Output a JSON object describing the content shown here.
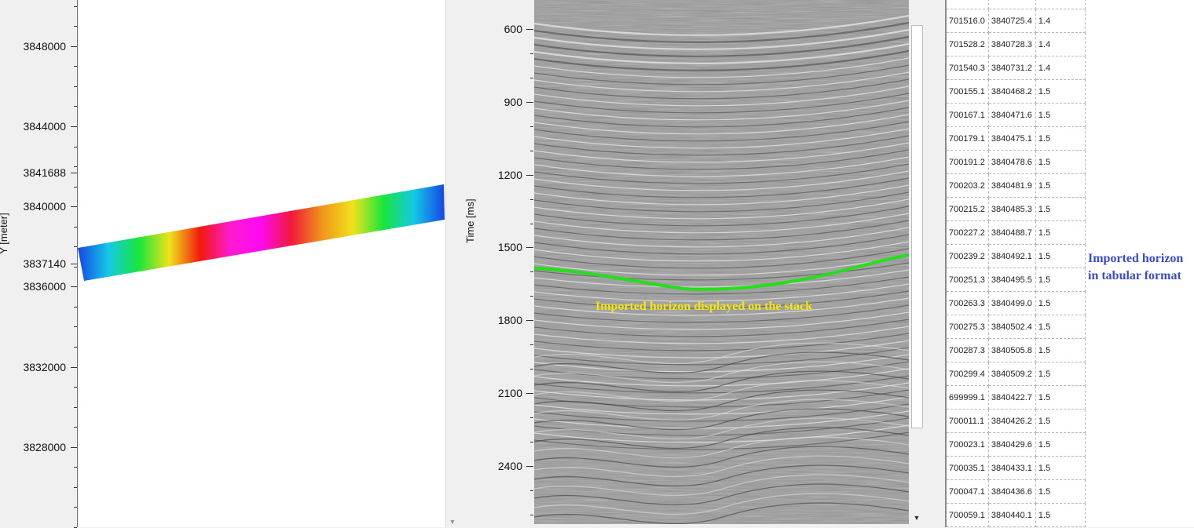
{
  "map_view": {
    "axis_title": "Y [meter]",
    "y_ticks": [
      "3848000",
      "3844000",
      "3841688",
      "3840000",
      "3837140",
      "3836000",
      "3832000",
      "3828000"
    ],
    "y_tick_values": [
      3848000,
      3844000,
      3841688,
      3840000,
      3837140,
      3836000,
      3832000,
      3828000
    ],
    "y_range": [
      3824000,
      3850300
    ],
    "colorbar_colors": [
      "#1546e6",
      "#15c8e6",
      "#18e63c",
      "#f0e21a",
      "#f01a0a",
      "#ff1ad2",
      "#ff0af0",
      "#f01a3a",
      "#f0961a",
      "#f0e21a",
      "#18e63c",
      "#15c8e6",
      "#1546e6"
    ]
  },
  "seismic_view": {
    "axis_title": "Time [ms]",
    "t_ticks": [
      "600",
      "900",
      "1200",
      "1500",
      "1800",
      "2100",
      "2400"
    ],
    "t_tick_values": [
      600,
      900,
      1200,
      1500,
      1800,
      2100,
      2400
    ],
    "t_range": [
      480,
      2640
    ],
    "annotation": "Imported horizon displayed on the stack",
    "horizon_color": "#22e01a"
  },
  "horizon_table": {
    "rows": [
      [
        "701516.0",
        "3840725.4",
        "1.4"
      ],
      [
        "701528.2",
        "3840728.3",
        "1.4"
      ],
      [
        "701540.3",
        "3840731.2",
        "1.4"
      ],
      [
        "700155.1",
        "3840468.2",
        "1.5"
      ],
      [
        "700167.1",
        "3840471.6",
        "1.5"
      ],
      [
        "700179.1",
        "3840475.1",
        "1.5"
      ],
      [
        "700191.2",
        "3840478.6",
        "1.5"
      ],
      [
        "700203.2",
        "3840481.9",
        "1.5"
      ],
      [
        "700215.2",
        "3840485.3",
        "1.5"
      ],
      [
        "700227.2",
        "3840488.7",
        "1.5"
      ],
      [
        "700239.2",
        "3840492.1",
        "1.5"
      ],
      [
        "700251.3",
        "3840495.5",
        "1.5"
      ],
      [
        "700263.3",
        "3840499.0",
        "1.5"
      ],
      [
        "700275.3",
        "3840502.4",
        "1.5"
      ],
      [
        "700287.3",
        "3840505.8",
        "1.5"
      ],
      [
        "700299.4",
        "3840509.2",
        "1.5"
      ],
      [
        "699999.1",
        "3840422.7",
        "1.5"
      ],
      [
        "700011.1",
        "3840426.2",
        "1.5"
      ],
      [
        "700023.1",
        "3840429.6",
        "1.5"
      ],
      [
        "700035.1",
        "3840433.1",
        "1.5"
      ],
      [
        "700047.1",
        "3840436.6",
        "1.5"
      ],
      [
        "700059.1",
        "3840440.1",
        "1.5"
      ]
    ],
    "note": "Imported horizon in tabular format"
  }
}
